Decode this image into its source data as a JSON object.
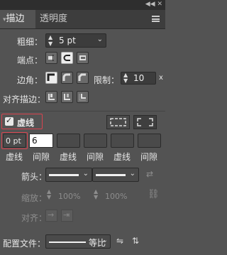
{
  "tabs": [
    {
      "label": "描边"
    },
    {
      "label": "透明度"
    }
  ],
  "stroke": {
    "weight_label": "粗细：",
    "weight_value": "5 pt",
    "cap_label": "端点：",
    "corner_label": "边角：",
    "limit_label": "限制：",
    "limit_value": "10",
    "limit_x": "x",
    "align_label": "对齐描边："
  },
  "dashed": {
    "checkbox_label": "虚线",
    "checked": true,
    "fields": [
      {
        "value": "0 pt",
        "label": "虚线"
      },
      {
        "value": "6",
        "label": "间隙"
      },
      {
        "value": "",
        "label": "虚线"
      },
      {
        "value": "",
        "label": "间隙"
      },
      {
        "value": "",
        "label": "虚线"
      },
      {
        "value": "",
        "label": "间隙"
      }
    ]
  },
  "arrows": {
    "arrow_label": "箭头：",
    "scale_label": "缩放：",
    "scale_start": "100%",
    "scale_end": "100%",
    "align_label": "对齐："
  },
  "profile": {
    "label": "配置文件：",
    "value": "等比"
  },
  "colors": {
    "panel_bg": "#535353",
    "tab_bar": "#3d3d3d",
    "highlight_red": "#d9434f"
  }
}
